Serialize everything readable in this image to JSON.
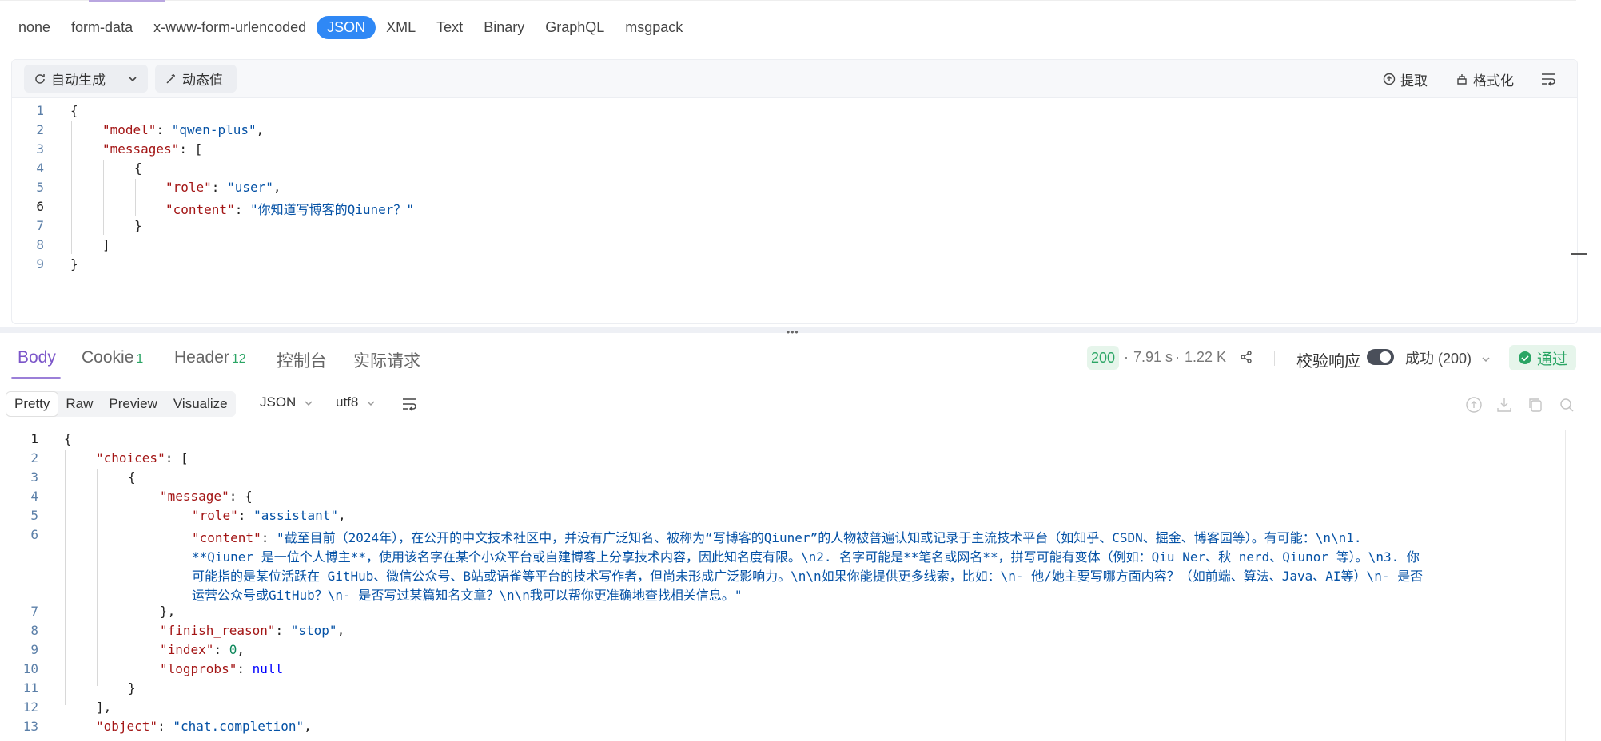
{
  "request": {
    "body_types": [
      "none",
      "form-data",
      "x-www-form-urlencoded",
      "JSON",
      "XML",
      "Text",
      "Binary",
      "GraphQL",
      "msgpack"
    ],
    "active_body_type": "JSON",
    "toolbar": {
      "auto_generate": "自动生成",
      "dynamic_value": "动态值",
      "extract": "提取",
      "format": "格式化"
    },
    "code_lines": [
      "1",
      "2",
      "3",
      "4",
      "5",
      "6",
      "7",
      "8",
      "9"
    ],
    "code": {
      "model_key": "\"model\"",
      "model_val": "\"qwen-plus\"",
      "messages_key": "\"messages\"",
      "role_key": "\"role\"",
      "role_val": "\"user\"",
      "content_key": "\"content\"",
      "content_val": "\"你知道写博客的Qiuner？\""
    }
  },
  "response": {
    "tabs": {
      "body": "Body",
      "cookie": "Cookie",
      "cookie_count": "1",
      "header": "Header",
      "header_count": "12",
      "console": "控制台",
      "actual_request": "实际请求"
    },
    "status_code": "200",
    "time": "7.91 s",
    "size": "1.22 K",
    "validate_label": "校验响应",
    "status_select": "成功 (200)",
    "pass_label": "通过",
    "formats": [
      "Pretty",
      "Raw",
      "Preview",
      "Visualize"
    ],
    "active_format": "Pretty",
    "lang_select": "JSON",
    "encoding_select": "utf8",
    "code_lines": [
      "1",
      "2",
      "3",
      "4",
      "5",
      "6",
      "",
      "",
      "",
      "7",
      "8",
      "9",
      "10",
      "11",
      "12",
      "13"
    ],
    "code": {
      "choices_key": "\"choices\"",
      "message_key": "\"message\"",
      "role_key": "\"role\"",
      "role_val": "\"assistant\"",
      "content_key": "\"content\"",
      "content_line1": "\"截至目前（2024年），在公开的中文技术社区中，并没有广泛知名、被称为“写博客的Qiuner”的人物被普遍认知或记录于主流技术平台（如知乎、CSDN、掘金、博客园等）。有可能：\\n\\n1.",
      "content_line2": "**Qiuner 是一位个人博主**，使用该名字在某个小众平台或自建博客上分享技术内容，因此知名度有限。\\n2. 名字可能是**笔名或网名**，拼写可能有变体（例如：Qiu Ner、秋 nerd、Qiunor 等）。\\n3. 你",
      "content_line3": "可能指的是某位活跃在 GitHub、微信公众号、B站或语雀等平台的技术写作者，但尚未形成广泛影响力。\\n\\n如果你能提供更多线索，比如：\\n- 他/她主要写哪方面内容？（如前端、算法、Java、AI等）\\n- 是否",
      "content_line4": "运营公众号或GitHub？\\n- 是否写过某篇知名文章？\\n\\n我可以帮你更准确地查找相关信息。\"",
      "finish_key": "\"finish_reason\"",
      "finish_val": "\"stop\"",
      "index_key": "\"index\"",
      "index_val": "0",
      "logprobs_key": "\"logprobs\"",
      "logprobs_val": "null",
      "object_key": "\"object\"",
      "object_val": "\"chat.completion\""
    }
  }
}
